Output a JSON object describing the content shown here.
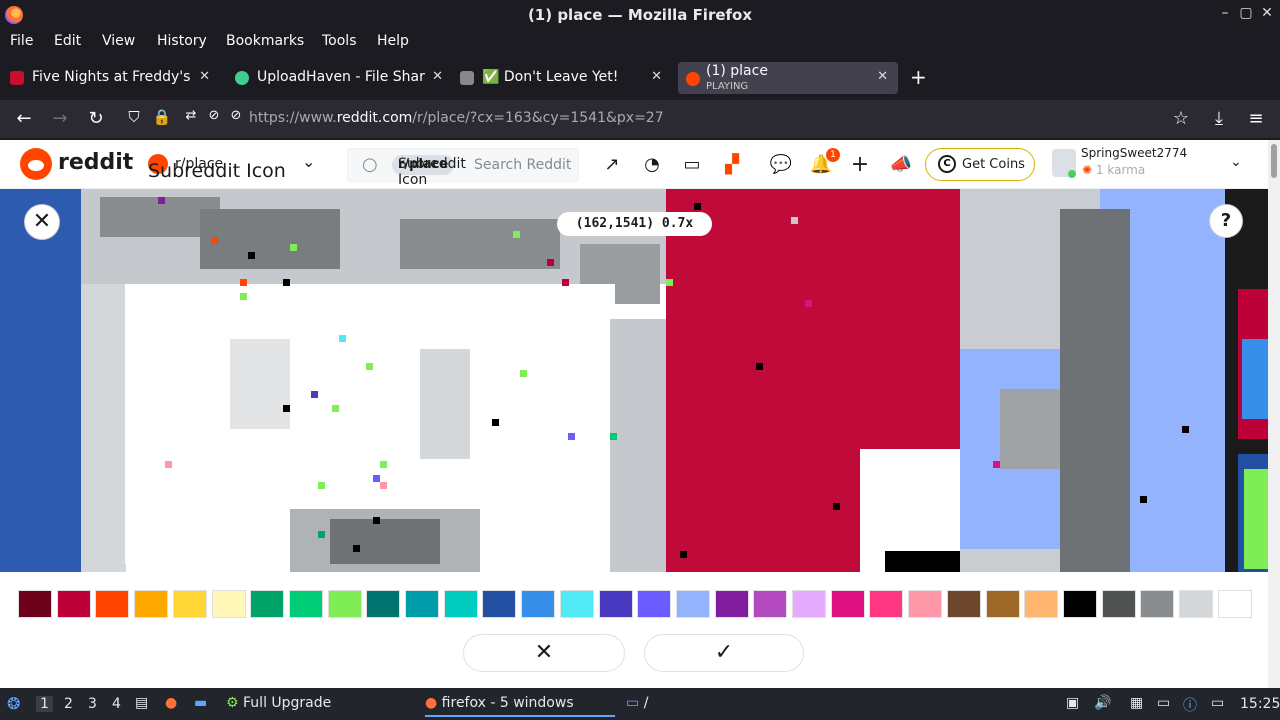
{
  "window": {
    "title": "(1) place — Mozilla Firefox",
    "controls": [
      "–",
      "▢",
      "✕"
    ]
  },
  "menu": [
    "File",
    "Edit",
    "View",
    "History",
    "Bookmarks",
    "Tools",
    "Help"
  ],
  "tabs": [
    {
      "label": "Five Nights at Freddy's: S",
      "favicon_color": "#c8102e"
    },
    {
      "label": "UploadHaven - File Sharin",
      "favicon_color": "#3ecf8e"
    },
    {
      "label": "✅ Don't Leave Yet!",
      "favicon_color": "#888888"
    },
    {
      "label": "(1) place",
      "sub": "PLAYING",
      "favicon_color": "#ff4500",
      "active": true
    }
  ],
  "new_tab": "+",
  "address": {
    "prefix": "https://www.",
    "domain": "reddit.com",
    "path": "/r/place/?cx=163&cy=1541&px=27"
  },
  "reddit": {
    "wordmark": "reddit",
    "subreddit": "r/place",
    "subreddit_icon_alt": "Subreddit Icon",
    "search_chip": "r/place",
    "search_chip_alt": "Subreddit Icon",
    "search_placeholder": "Search Reddit",
    "notif_count": "1",
    "get_coins": "Get Coins",
    "username": "SpringSweet2774",
    "karma": "1 karma"
  },
  "canvas": {
    "coordinates": "(162,1541) 0.7x",
    "close_icon": "close-icon",
    "help_icon": "help-icon"
  },
  "palette": [
    "#6d001a",
    "#be0039",
    "#ff4500",
    "#ffa800",
    "#ffd635",
    "#fff8b8",
    "#00a368",
    "#00cc78",
    "#7eed56",
    "#00756f",
    "#009eaa",
    "#00ccc0",
    "#2450a4",
    "#3690ea",
    "#51e9f4",
    "#493ac1",
    "#6a5cff",
    "#94b3ff",
    "#811e9f",
    "#b44ac0",
    "#e4abff",
    "#de107f",
    "#ff3881",
    "#ff99aa",
    "#6d482f",
    "#9c6926",
    "#ffb470",
    "#000000",
    "#515252",
    "#898d90",
    "#d4d7d9",
    "#ffffff"
  ],
  "actions": {
    "cancel": "✕",
    "confirm": "✓"
  },
  "taskbar": {
    "workspaces": [
      "1",
      "2",
      "3",
      "4"
    ],
    "upgrade": "Full Upgrade",
    "firefox": "firefox - 5 windows",
    "folder": "/",
    "clock": "15:25"
  }
}
